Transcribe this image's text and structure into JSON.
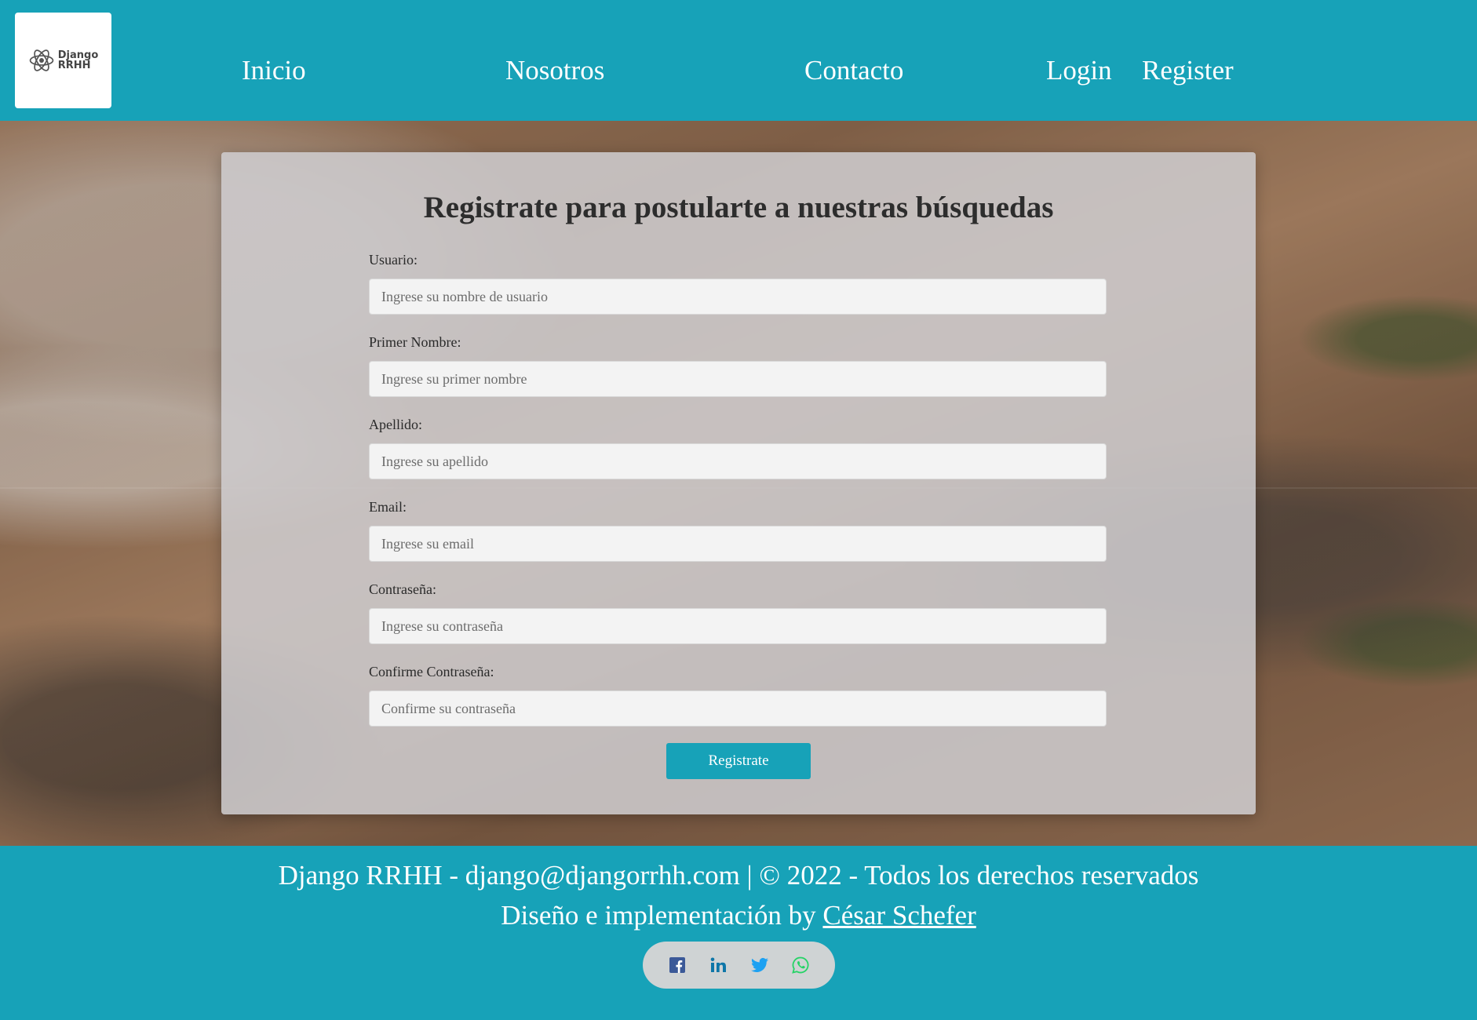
{
  "header": {
    "logo": {
      "line1": "Django",
      "line2": "RRHH"
    },
    "nav": {
      "home": "Inicio",
      "about": "Nosotros",
      "contact": "Contacto",
      "login": "Login",
      "register": "Register"
    }
  },
  "form": {
    "title": "Registrate para postularte a nuestras búsquedas",
    "fields": {
      "username": {
        "label": "Usuario:",
        "placeholder": "Ingrese su nombre de usuario"
      },
      "first_name": {
        "label": "Primer Nombre:",
        "placeholder": "Ingrese su primer nombre"
      },
      "last_name": {
        "label": "Apellido:",
        "placeholder": "Ingrese su apellido"
      },
      "email": {
        "label": "Email:",
        "placeholder": "Ingrese su email"
      },
      "password": {
        "label": "Contraseña:",
        "placeholder": "Ingrese su contraseña"
      },
      "password_confirm": {
        "label": "Confirme Contraseña:",
        "placeholder": "Confirme su contraseña"
      }
    },
    "submit_label": "Registrate"
  },
  "footer": {
    "line1": "Django RRHH - django@djangorrhh.com | © 2022 - Todos los derechos reservados",
    "line2_prefix": "Diseño e implementación by ",
    "author": "César Schefer",
    "social": [
      "facebook-icon",
      "linkedin-icon",
      "twitter-icon",
      "whatsapp-icon"
    ]
  },
  "colors": {
    "brand": "#17a2b8",
    "facebook": "#3b5998",
    "linkedin": "#0e76a8",
    "twitter": "#1da1f2",
    "whatsapp": "#25d366"
  }
}
